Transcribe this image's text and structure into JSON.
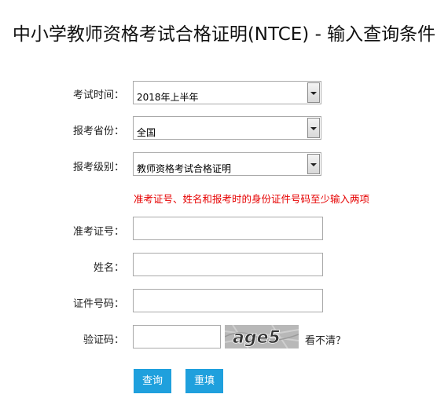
{
  "page": {
    "title": "中小学教师资格考试合格证明(NTCE) - 输入查询条件"
  },
  "form": {
    "exam_time": {
      "label": "考试时间：",
      "value": "2018年上半年"
    },
    "province": {
      "label": "报考省份：",
      "value": "全国"
    },
    "level": {
      "label": "报考级别：",
      "value": "教师资格考试合格证明"
    },
    "warning": "准考证号、姓名和报考时的身份证件号码至少输入两项",
    "admission_no": {
      "label": "准考证号：",
      "value": ""
    },
    "name": {
      "label": "姓名：",
      "value": ""
    },
    "id_no": {
      "label": "证件号码：",
      "value": ""
    },
    "captcha": {
      "label": "验证码：",
      "value": "",
      "image_text": "age5",
      "refresh": "看不清？"
    }
  },
  "actions": {
    "query": "查询",
    "reset": "重填",
    "color": "#1fa0dd"
  },
  "icons": {
    "dropdown": "chevron-down-icon"
  }
}
